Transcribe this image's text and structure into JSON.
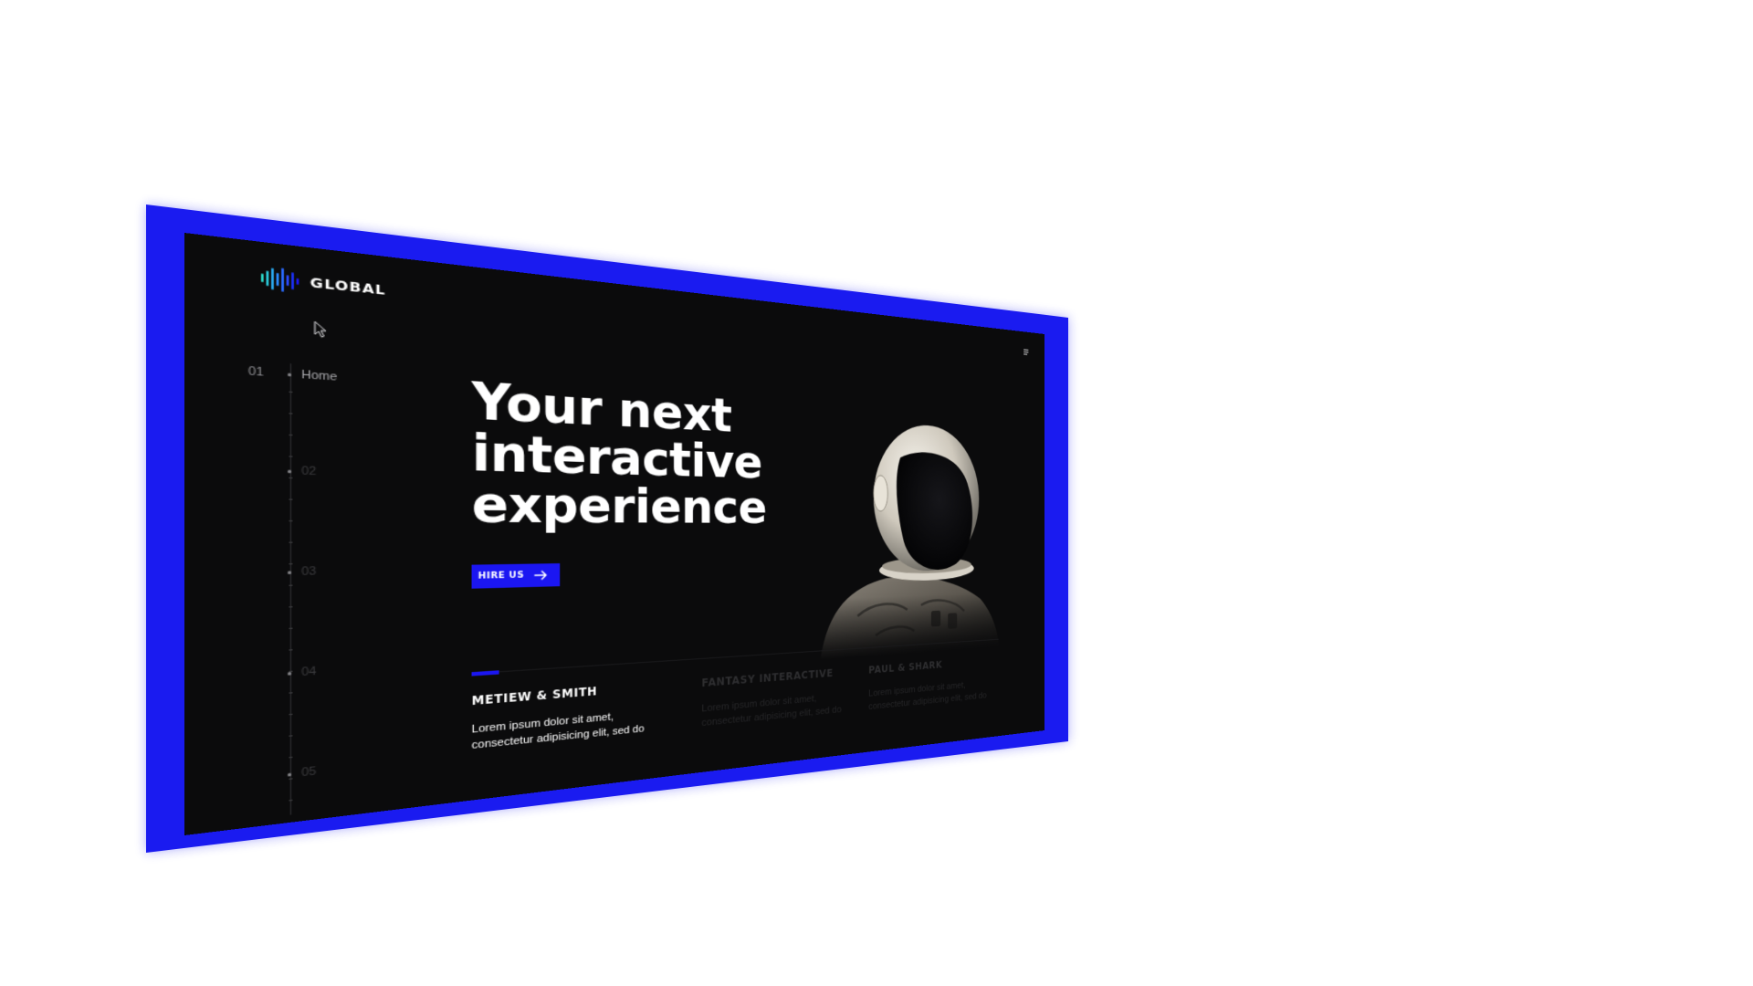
{
  "brand": {
    "name": "GLOBAL",
    "colors": {
      "frame_blue": "#1a1bf0",
      "accent_blue": "#1b16f2",
      "background": "#0b0b0c",
      "logo_gradient": [
        "#2ad7c6",
        "#2a8bff",
        "#1b16f2"
      ]
    }
  },
  "nav": {
    "menu_icon": "hamburger-menu-icon",
    "cursor_icon": "mouse-pointer-icon",
    "side_items": [
      {
        "number": "01",
        "label": "Home"
      },
      {
        "number": "",
        "label": "02"
      },
      {
        "number": "",
        "label": "03"
      },
      {
        "number": "",
        "label": "04"
      },
      {
        "number": "",
        "label": "05"
      }
    ]
  },
  "hero": {
    "title_lines": [
      "Your next",
      "interactive",
      "experience"
    ],
    "cta_label": "HIRE US",
    "cta_icon": "arrow-right-icon",
    "image": "astronaut-photo"
  },
  "slider": {
    "progress_fraction": 0.04
  },
  "cards": [
    {
      "title": "METIEW & SMITH",
      "text": "Lorem ipsum dolor sit amet, consectetur adipisicing elit, sed do"
    },
    {
      "title": "FANTASY INTERACTIVE",
      "text": "Lorem ipsum dolor sit amet, consectetur adipisicing elit, sed do"
    },
    {
      "title": "PAUL & SHARK",
      "text": "Lorem ipsum dolor sit amet, consectetur adipisicing elit, sed do"
    }
  ]
}
